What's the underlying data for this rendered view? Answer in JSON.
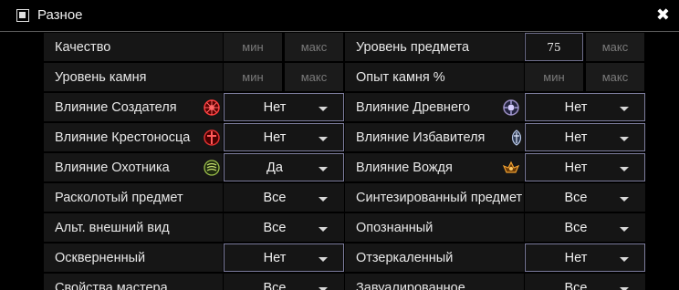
{
  "window": {
    "title": "Разное",
    "close_glyph": "✖"
  },
  "rows": [
    {
      "left": {
        "label": "Качество",
        "min": "мин",
        "max": "макс"
      },
      "right": {
        "label": "Уровень предмета",
        "min_value": "75",
        "max": "макс"
      }
    },
    {
      "left": {
        "label": "Уровень камня",
        "min": "мин",
        "max": "макс"
      },
      "right": {
        "label": "Опыт камня %",
        "min": "мин",
        "max": "макс"
      }
    },
    {
      "left": {
        "label": "Влияние Создателя",
        "icon": "shaper-influence-icon",
        "value": "Нет"
      },
      "right": {
        "label": "Влияние Древнего",
        "icon": "elder-influence-icon",
        "value": "Нет"
      }
    },
    {
      "left": {
        "label": "Влияние Крестоносца",
        "icon": "crusader-influence-icon",
        "value": "Нет"
      },
      "right": {
        "label": "Влияние Избавителя",
        "icon": "redeemer-influence-icon",
        "value": "Нет"
      }
    },
    {
      "left": {
        "label": "Влияние Охотника",
        "icon": "hunter-influence-icon",
        "value": "Да"
      },
      "right": {
        "label": "Влияние Вождя",
        "icon": "warlord-influence-icon",
        "value": "Нет"
      }
    },
    {
      "left": {
        "label": "Расколотый предмет",
        "value": "Все"
      },
      "right": {
        "label": "Синтезированный предмет",
        "value": "Все"
      }
    },
    {
      "left": {
        "label": "Альт. внешний вид",
        "value": "Все"
      },
      "right": {
        "label": "Опознанный",
        "value": "Все"
      }
    },
    {
      "left": {
        "label": "Оскверненный",
        "value": "Нет"
      },
      "right": {
        "label": "Отзеркаленный",
        "value": "Нет"
      }
    },
    {
      "left": {
        "label": "Свойства мастера",
        "value": "Все"
      },
      "right": {
        "label": "Завуалированное",
        "value": "Все"
      }
    }
  ],
  "colors": {
    "background": "#000000",
    "cell": "#161616",
    "active_border": "#7c7c9c",
    "text": "#e8e8e8",
    "placeholder": "#7a7a7a"
  }
}
